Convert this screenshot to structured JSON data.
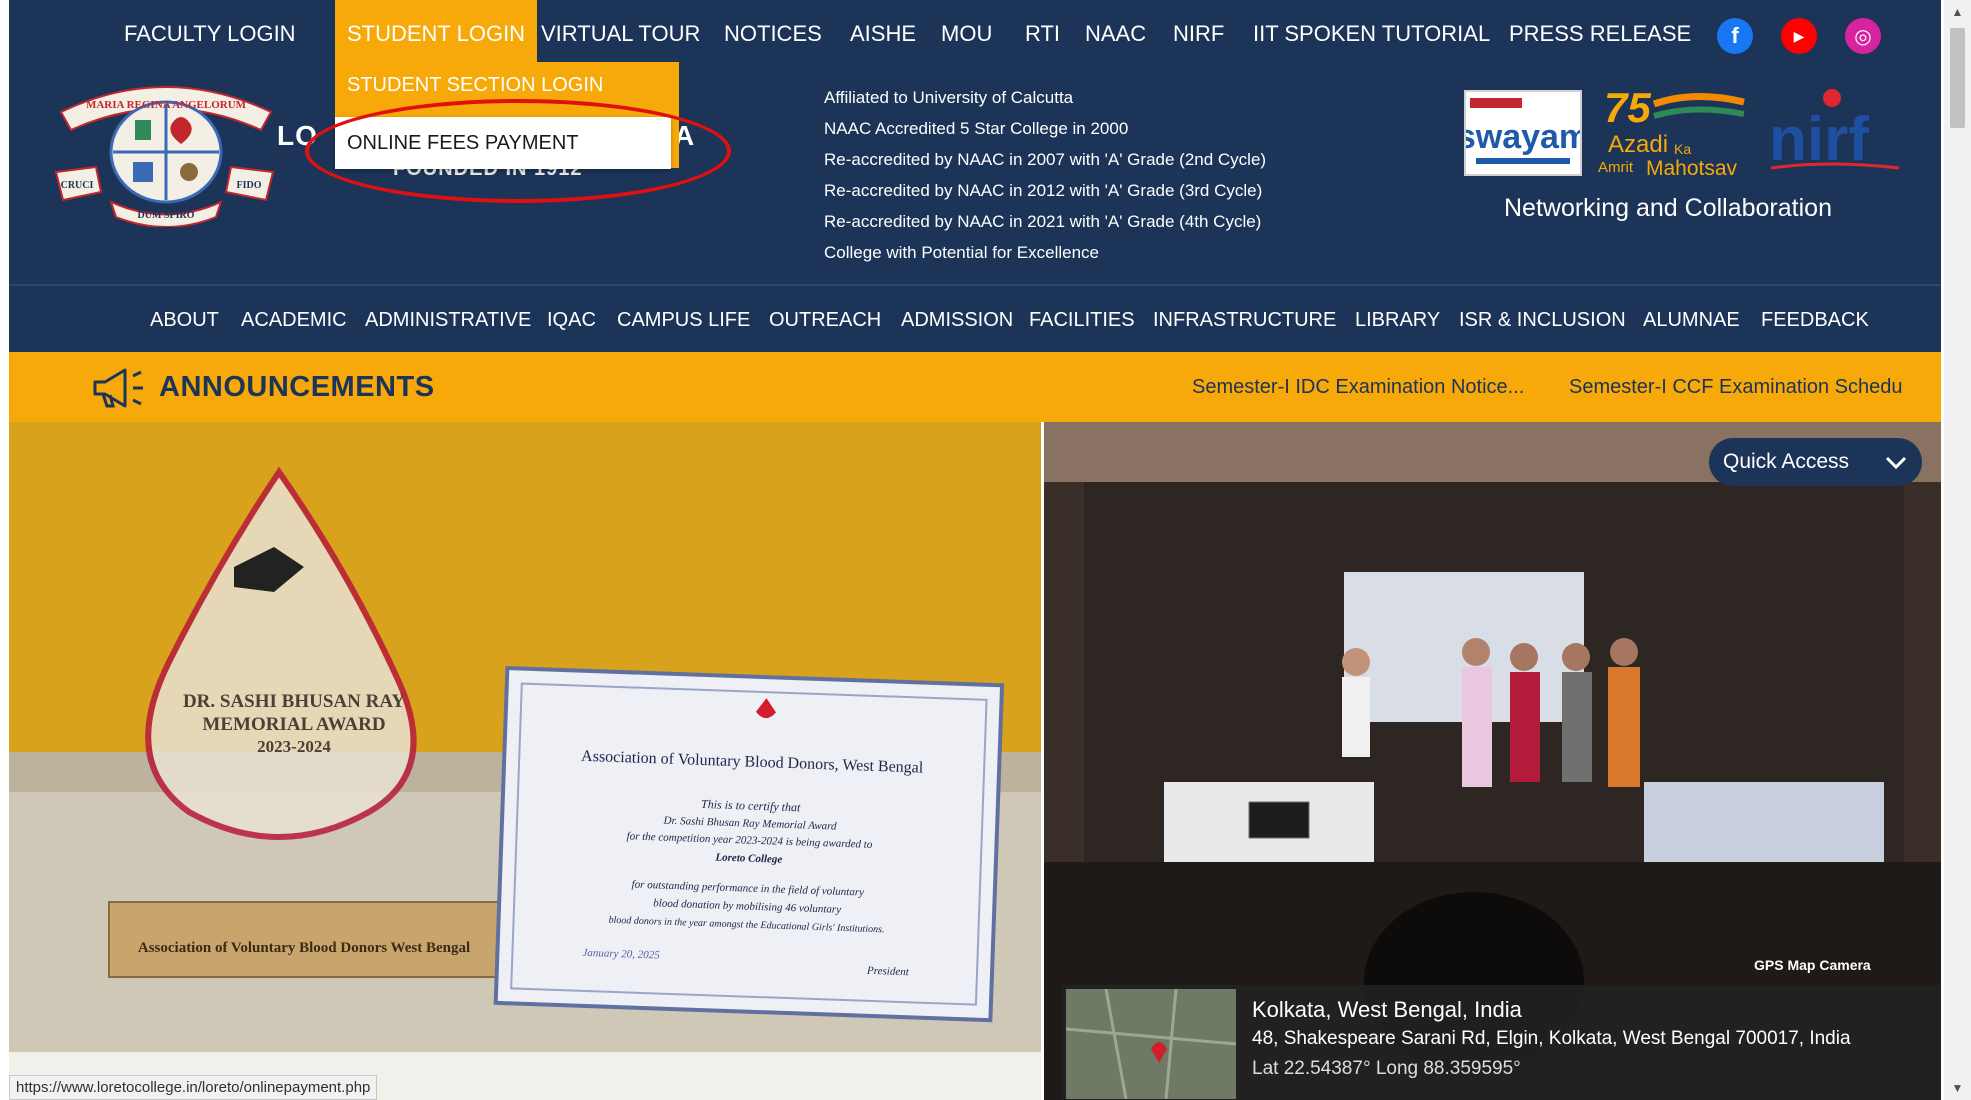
{
  "topnav": {
    "items": [
      {
        "label": "FACULTY LOGIN"
      },
      {
        "label": "STUDENT LOGIN"
      },
      {
        "label": "VIRTUAL TOUR"
      },
      {
        "label": "NOTICES"
      },
      {
        "label": "AISHE"
      },
      {
        "label": "MOU"
      },
      {
        "label": "RTI"
      },
      {
        "label": "NAAC"
      },
      {
        "label": "NIRF"
      },
      {
        "label": "IIT SPOKEN TUTORIAL"
      },
      {
        "label": "PRESS RELEASE"
      }
    ],
    "active_item": "STUDENT LOGIN",
    "social": [
      {
        "icon": "facebook-icon",
        "color": "#1877f2",
        "glyph": "f"
      },
      {
        "icon": "youtube-icon",
        "color": "#ff0000",
        "glyph": "▶"
      },
      {
        "icon": "instagram-icon",
        "color": "#d6249f",
        "glyph": "◎"
      }
    ]
  },
  "dropdown": {
    "items": [
      {
        "label": "STUDENT SECTION LOGIN"
      },
      {
        "label": "ONLINE FEES PAYMENT"
      }
    ]
  },
  "header": {
    "college_name_visible_start": "LO",
    "college_name_visible_end": "A",
    "college_sub": "FOUNDED IN 1912",
    "logo_motto": [
      "MARIA REGINA ANGELORUM",
      "CRUCI",
      "DUM SPIRO",
      "FIDO"
    ],
    "accreditation": [
      "Affiliated to University of Calcutta",
      "NAAC Accredited 5 Star College in 2000",
      "Re-accredited by NAAC in 2007 with 'A' Grade (2nd Cycle)",
      "Re-accredited by NAAC in 2012 with 'A' Grade (3rd Cycle)",
      "Re-accredited by NAAC in 2021 with 'A' Grade (4th Cycle)",
      "College with Potential for Excellence"
    ],
    "partners": {
      "swayam": "swayam",
      "azadi_line1": "Azadi",
      "azadi_ka": "Ka",
      "azadi_line2": "Amrit",
      "azadi_line3": "Mahotsav",
      "azadi_75": "75",
      "nirf": "nirf"
    },
    "networking": "Networking and Collaboration"
  },
  "mainnav": {
    "items": [
      {
        "label": "ABOUT"
      },
      {
        "label": "ACADEMIC"
      },
      {
        "label": "ADMINISTRATIVE"
      },
      {
        "label": "IQAC"
      },
      {
        "label": "CAMPUS LIFE"
      },
      {
        "label": "OUTREACH"
      },
      {
        "label": "ADMISSION"
      },
      {
        "label": "FACILITIES"
      },
      {
        "label": "INFRASTRUCTURE"
      },
      {
        "label": "LIBRARY"
      },
      {
        "label": "ISR & INCLUSION"
      },
      {
        "label": "ALUMNAE"
      },
      {
        "label": "FEEDBACK"
      }
    ]
  },
  "announcements": {
    "title": "ANNOUNCEMENTS",
    "ticker": [
      "Semester-I IDC Examination Notice...",
      "Semester-I CCF Examination Schedu"
    ]
  },
  "slider": {
    "award_text": [
      "DR. SASHI BHUSAN RAY",
      "MEMORIAL AWARD",
      "2023-2024"
    ],
    "award_base": "Association of Voluntary Blood Donors West Bengal",
    "certificate_org": "Association of Voluntary Blood Donors, West Bengal",
    "certificate_lines": [
      "This is to certify that",
      "Dr. Sashi Bhusan Ray Memorial Award",
      "for the competition year 2023-2024 is being awarded to",
      "Loreto College",
      "for outstanding performance in the field of voluntary",
      "blood donation by mobilising 46 voluntary",
      "blood donors in the year amongst the Educational Girls' Institutions."
    ],
    "certificate_date": "January 20, 2025",
    "certificate_sign": "President",
    "quick_access": "Quick Access",
    "gps": {
      "label": "GPS Map Camera",
      "line1": "Kolkata, West Bengal, India",
      "line2": "48, Shakespeare Sarani Rd, Elgin, Kolkata, West Bengal 700017, India",
      "line3": "Lat 22.54387° Long 88.359595°"
    }
  },
  "status_url": "https://www.loretocollege.in/loreto/onlinepayment.php",
  "colors": {
    "navy": "#1c3457",
    "amber": "#f6a909",
    "highlight_circle": "#e01010"
  }
}
